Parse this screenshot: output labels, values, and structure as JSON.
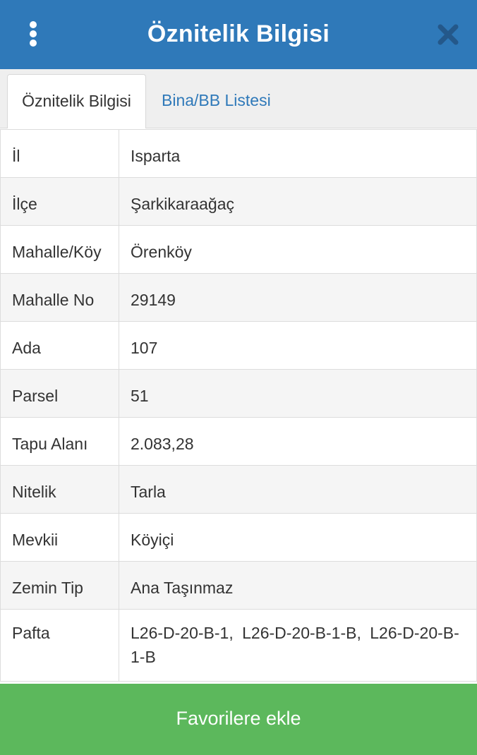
{
  "header": {
    "title": "Öznitelik Bilgisi",
    "menu_icon": "vertical-dots-icon",
    "close_icon": "close-icon",
    "background": "#2f79b9"
  },
  "tabs": [
    {
      "label": "Öznitelik Bilgisi",
      "active": true
    },
    {
      "label": "Bina/BB Listesi",
      "active": false
    }
  ],
  "attributes": [
    {
      "key": "İl",
      "value": "Isparta"
    },
    {
      "key": "İlçe",
      "value": "Şarkikaraağaç"
    },
    {
      "key": "Mahalle/Köy",
      "value": "Örenköy"
    },
    {
      "key": "Mahalle No",
      "value": "29149"
    },
    {
      "key": "Ada",
      "value": "107"
    },
    {
      "key": "Parsel",
      "value": "51"
    },
    {
      "key": "Tapu Alanı",
      "value": "2.083,28"
    },
    {
      "key": "Nitelik",
      "value": "Tarla"
    },
    {
      "key": "Mevkii",
      "value": "Köyiçi"
    },
    {
      "key": "Zemin Tip",
      "value": "Ana Taşınmaz"
    },
    {
      "key": "Pafta",
      "value": "L26-D-20-B-1, L26-D-20-B-1-B, L26-D-20-B-1-B"
    }
  ],
  "footer": {
    "button_label": "Favorilere ekle",
    "button_color": "#5cb85c"
  }
}
